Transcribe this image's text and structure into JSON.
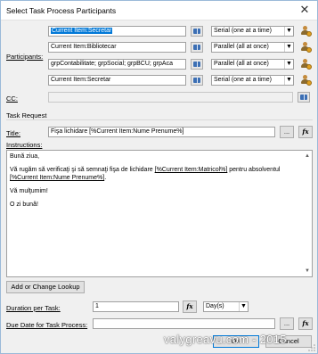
{
  "window": {
    "title": "Select Task Process Participants",
    "close_glyph": "✕"
  },
  "participants": {
    "label": "Participants:",
    "rows": [
      {
        "value": "Current Item:Secretar",
        "selected": true,
        "order": "Serial (one at a time)"
      },
      {
        "value": "Current Item:Bibliotecar",
        "selected": false,
        "order": "Parallel (all at once)"
      },
      {
        "value": "grpContabilitate; grpSocial; grpBCU; grpAca",
        "selected": false,
        "order": "Parallel (all at once)"
      },
      {
        "value": "Current Item:Secretar",
        "selected": false,
        "order": "Serial (one at a time)"
      }
    ]
  },
  "cc": {
    "label": "CC:",
    "value": ""
  },
  "task_request": {
    "header": "Task Request",
    "title_label": "Title:",
    "title_value": "Fişa lichidare [%Current Item:Nume Prenume%]",
    "ellipsis": "...",
    "fx": "fx",
    "instructions_label": "Instructions:",
    "instructions": {
      "line1": "Bună ziua,",
      "line2_pre": "Vă rugăm să verificaţi şi să semnaţi fişa de lichidare ",
      "lookup1": "[%Current Item:Matricol%]",
      "line2_post": " pentru absolventul ",
      "lookup2": "[%Current Item:Nume Prenume%]",
      "line2_end": ".",
      "line3": "Vă mulţumim!",
      "line4": "O zi bună!"
    }
  },
  "lookup_button": "Add or Change Lookup",
  "duration": {
    "label": "Duration per Task:",
    "value": "1",
    "unit": "Day(s)"
  },
  "due_date": {
    "label": "Due Date for Task Process:",
    "value": ""
  },
  "buttons": {
    "ok": "OK",
    "cancel": "Cancel"
  },
  "watermark": "valygreavu.com - 2015",
  "colors": {
    "selection": "#0078d7",
    "window_bg": "#f0f0f0"
  },
  "icons": [
    "address-book-icon",
    "person-settings-icon",
    "fx-icon",
    "dropdown-arrow-icon"
  ]
}
